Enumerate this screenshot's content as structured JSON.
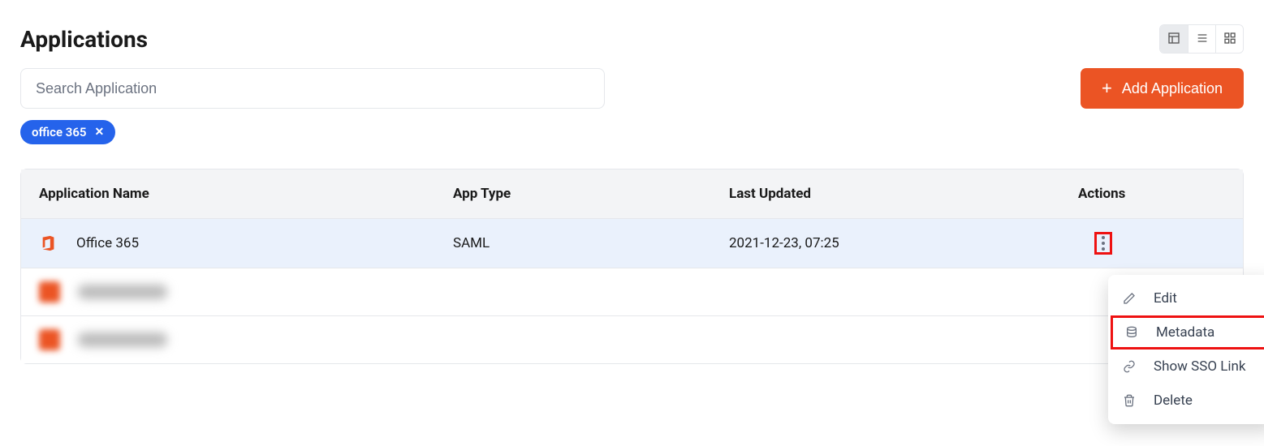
{
  "page_title": "Applications",
  "search_placeholder": "Search Application",
  "add_button_label": "Add Application",
  "filter_chip": "office 365",
  "columns": {
    "name": "Application Name",
    "type": "App Type",
    "updated": "Last Updated",
    "actions": "Actions"
  },
  "rows": [
    {
      "name": "Office 365",
      "type": "SAML",
      "updated": "2021-12-23, 07:25"
    }
  ],
  "dropdown": {
    "edit": "Edit",
    "metadata": "Metadata",
    "sso": "Show SSO Link",
    "delete": "Delete"
  }
}
